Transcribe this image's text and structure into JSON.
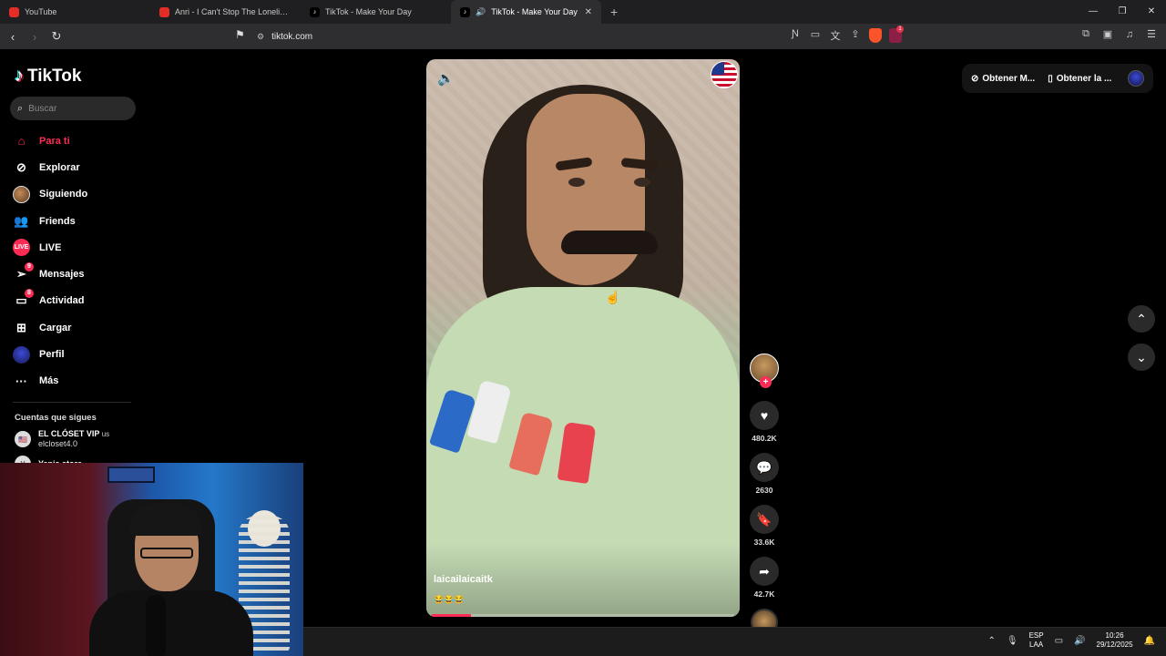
{
  "browser": {
    "tabs": [
      {
        "title": "YouTube",
        "favicon": "youtube-icon"
      },
      {
        "title": "Anri - I Can't Stop The Loneliness (Su",
        "favicon": "youtube-icon"
      },
      {
        "title": "TikTok - Make Your Day",
        "favicon": "tiktok-icon"
      },
      {
        "title": "TikTok - Make Your Day",
        "favicon": "tiktok-icon",
        "active": true,
        "audio": true
      }
    ],
    "url": "tiktok.com",
    "rewards_badge": "1"
  },
  "sidebar": {
    "logo_text": "TikTok",
    "search_placeholder": "Buscar",
    "items": [
      {
        "label": "Para ti",
        "icon": "home-icon",
        "active": true
      },
      {
        "label": "Explorar",
        "icon": "compass-icon"
      },
      {
        "label": "Siguiendo",
        "icon": "following-avatar-icon"
      },
      {
        "label": "Friends",
        "icon": "friends-icon"
      },
      {
        "label": "LIVE",
        "icon": "live-icon"
      },
      {
        "label": "Mensajes",
        "icon": "messages-icon",
        "badge": "9"
      },
      {
        "label": "Actividad",
        "icon": "activity-icon",
        "badge": "8"
      },
      {
        "label": "Cargar",
        "icon": "upload-icon"
      },
      {
        "label": "Perfil",
        "icon": "profile-icon"
      },
      {
        "label": "Más",
        "icon": "more-icon"
      }
    ],
    "following_title": "Cuentas que sigues",
    "accounts": [
      {
        "name": "EL CLÓSET VIP",
        "suffix": "us",
        "handle": "elcloset4.0"
      },
      {
        "name": "Yanis store",
        "suffix": "",
        "handle": ""
      }
    ]
  },
  "video": {
    "author": "laicailaicaitk",
    "caption": "😂😂😂",
    "progress": 0.13
  },
  "actions": {
    "likes": "480.2K",
    "comments": "2630",
    "saves": "33.6K",
    "shares": "42.7K"
  },
  "header_right": {
    "get_coins": "Obtener M...",
    "get_app": "Obtener la ..."
  },
  "taskbar": {
    "lang_top": "ESP",
    "lang_bottom": "LAA",
    "time": "10:26",
    "date": "29/12/2025"
  },
  "colors": {
    "accent": "#fe2c55",
    "background": "#000000"
  }
}
